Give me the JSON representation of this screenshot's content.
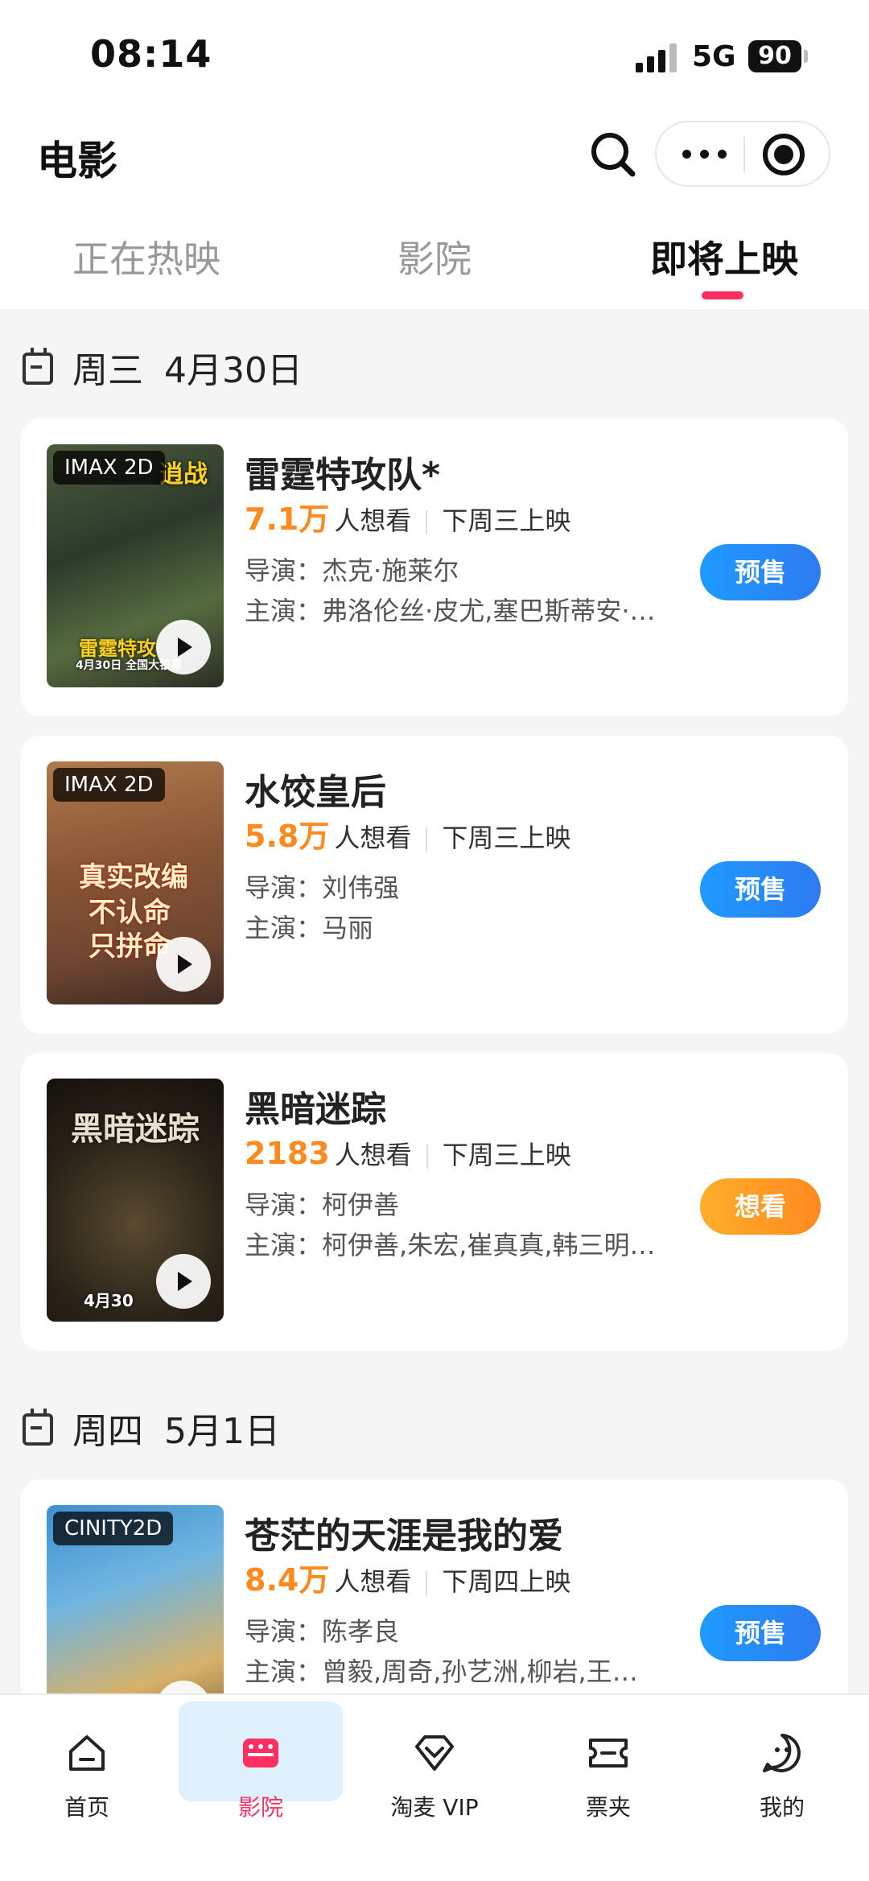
{
  "status_bar": {
    "time": "08:14",
    "network": "5G",
    "battery": "90"
  },
  "nav": {
    "title": "电影"
  },
  "tabs": [
    {
      "label": "正在热映"
    },
    {
      "label": "影院"
    },
    {
      "label": "即将上映"
    }
  ],
  "sections": [
    {
      "weekday": "周三",
      "date": "4月30日",
      "movies": [
        {
          "title": "雷霆特攻队*",
          "want_count": "7.1万",
          "want_label": "人想看",
          "release": "下周三上映",
          "director_label": "导演：",
          "director": "杰克·施莱尔",
          "cast_label": "主演：",
          "cast": "弗洛伦丝·皮尤,塞巴斯蒂安·…",
          "format_tag": "IMAX 2D",
          "poster_badge": "逍战",
          "poster_caption": "雷霆特攻",
          "poster_date": "4月30日 全国大银幕",
          "button": "预售",
          "button_style": "blue"
        },
        {
          "title": "水饺皇后",
          "want_count": "5.8万",
          "want_label": "人想看",
          "release": "下周三上映",
          "director_label": "导演：",
          "director": "刘伟强",
          "cast_label": "主演：",
          "cast": "马丽",
          "format_tag": "IMAX 2D",
          "poster_lines": [
            "真实改编",
            "不认命",
            "只拼命"
          ],
          "button": "预售",
          "button_style": "blue"
        },
        {
          "title": "黑暗迷踪",
          "want_count": "2183",
          "want_label": "人想看",
          "release": "下周三上映",
          "director_label": "导演：",
          "director": "柯伊善",
          "cast_label": "主演：",
          "cast": "柯伊善,朱宏,崔真真,韩三明…",
          "poster_title": "黑暗迷踪",
          "poster_date": "4月30",
          "button": "想看",
          "button_style": "orange"
        }
      ]
    },
    {
      "weekday": "周四",
      "date": "5月1日",
      "movies": [
        {
          "title": "苍茫的天涯是我的爱",
          "want_count": "8.4万",
          "want_label": "人想看",
          "release": "下周四上映",
          "director_label": "导演：",
          "director": "陈孝良",
          "cast_label": "主演：",
          "cast": "曾毅,周奇,孙艺洲,柳岩,王…",
          "format_tag": "CINITY2D",
          "button": "预售",
          "button_style": "blue"
        }
      ]
    }
  ],
  "tabbar": [
    {
      "label": "首页",
      "icon": "home-icon"
    },
    {
      "label": "影院",
      "icon": "cinema-icon",
      "active": true
    },
    {
      "label": "淘麦 VIP",
      "icon": "vip-diamond-icon"
    },
    {
      "label": "票夹",
      "icon": "ticket-icon"
    },
    {
      "label": "我的",
      "icon": "profile-icon"
    }
  ],
  "colors": {
    "accent_pink": "#ff2f62",
    "want_orange": "#ff8a1f",
    "button_blue": "#1e9bff",
    "button_orange": "#ff9a24",
    "active_tab_bg": "#dff0fd"
  }
}
